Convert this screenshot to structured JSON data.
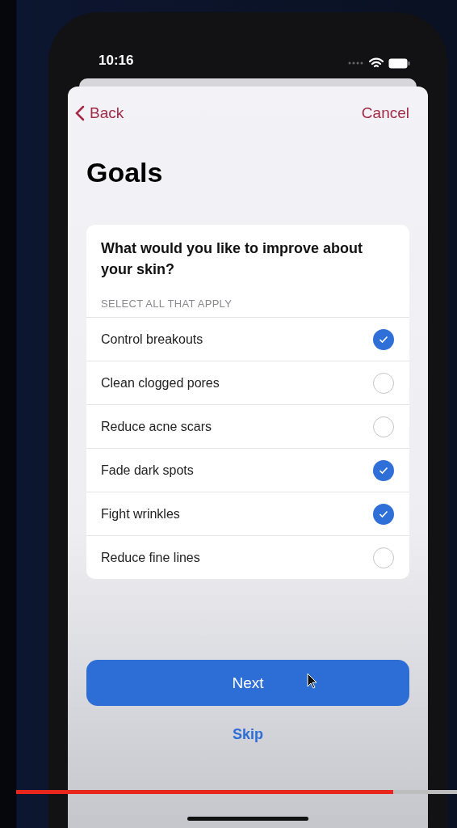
{
  "status_bar": {
    "time": "10:16"
  },
  "nav": {
    "back": "Back",
    "cancel": "Cancel"
  },
  "title": "Goals",
  "question": {
    "prompt": "What would you like to improve about your skin?",
    "instruction": "SELECT ALL THAT APPLY",
    "options": [
      {
        "label": "Control breakouts",
        "checked": true
      },
      {
        "label": "Clean clogged pores",
        "checked": false
      },
      {
        "label": "Reduce acne scars",
        "checked": false
      },
      {
        "label": "Fade dark spots",
        "checked": true
      },
      {
        "label": "Fight wrinkles",
        "checked": true
      },
      {
        "label": "Reduce fine lines",
        "checked": false
      }
    ]
  },
  "buttons": {
    "next": "Next",
    "skip": "Skip"
  },
  "video_progress": {
    "level": 0.855
  }
}
